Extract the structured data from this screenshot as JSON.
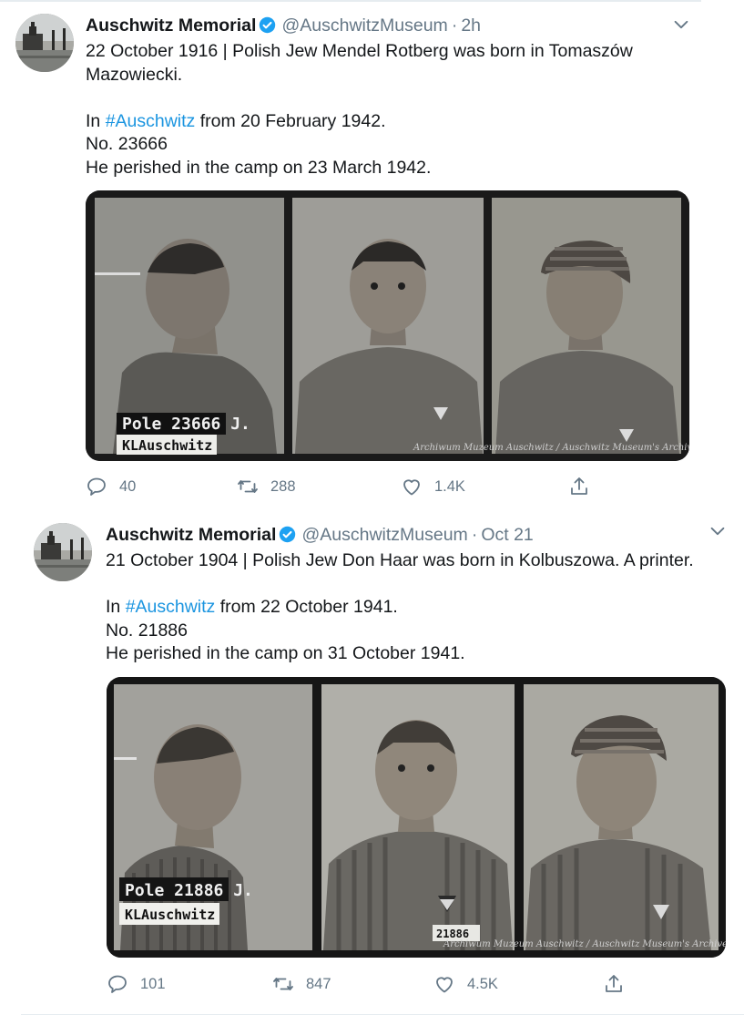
{
  "tweets": [
    {
      "author_name": "Auschwitz Memorial",
      "handle": "@AuschwitzMuseum",
      "separator": "·",
      "time": "2h",
      "text_line1": "22 October 1916 | Polish Jew Mendel Rotberg was born in Tomaszów Mazowiecki.",
      "in_prefix": "In ",
      "hashtag": "#Auschwitz",
      "in_suffix": " from 20 February 1942.",
      "number_line": "No. 23666",
      "perished_line": "He perished in the camp on 23 March 1942.",
      "photo": {
        "sign_top": "Pole 23666 J.",
        "sign_bottom": "KLAuschwitz",
        "watermark": "Archiwum Muzeum Auschwitz / Auschwitz Museum's Archive"
      },
      "replies": "40",
      "retweets": "288",
      "likes": "1.4K"
    },
    {
      "author_name": "Auschwitz Memorial",
      "handle": "@AuschwitzMuseum",
      "separator": "·",
      "time": "Oct 21",
      "text_line1": "21 October 1904 | Polish Jew Don Haar was born in Kolbuszowa. A printer.",
      "in_prefix": "In ",
      "hashtag": "#Auschwitz",
      "in_suffix": " from 22 October 1941.",
      "number_line": "No. 21886",
      "perished_line": "He perished in the camp on 31 October 1941.",
      "photo": {
        "sign_top": "Pole 21886 J.",
        "sign_bottom": "KLAuschwitz",
        "watermark": "Archiwum Muzeum Auschwitz / Auschwitz Museum's Archive",
        "tag": "21886"
      },
      "replies": "101",
      "retweets": "847",
      "likes": "4.5K"
    }
  ],
  "icons": {
    "verified": "verified-badge-icon",
    "caret": "chevron-down-icon",
    "reply": "reply-icon",
    "retweet": "retweet-icon",
    "like": "heart-icon",
    "share": "share-icon"
  },
  "colors": {
    "verified": "#1da1f2",
    "hashtag": "#1b95e0",
    "muted": "#657786",
    "text": "#14171a"
  }
}
